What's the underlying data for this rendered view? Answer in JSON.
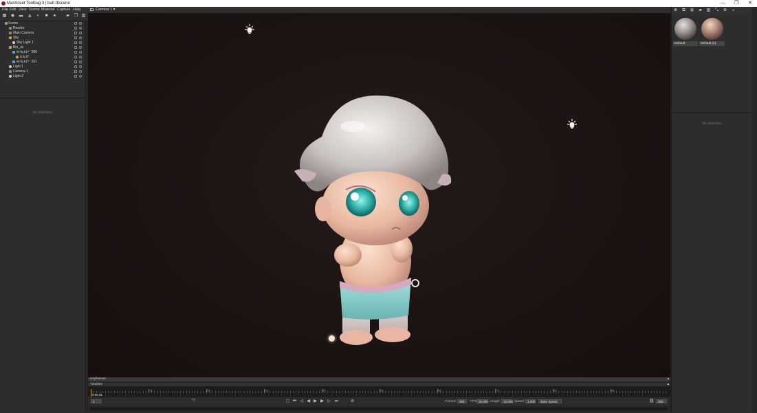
{
  "window": {
    "title": "Marmoset Toolbag 3  |  bah.tbscene",
    "controls": [
      "—",
      "❐",
      "✕"
    ]
  },
  "menu": [
    "File",
    "Edit",
    "View",
    "Scene",
    "Material",
    "Capture",
    "Help"
  ],
  "outliner": {
    "items": [
      {
        "label": "Scene",
        "icon": "scene-icon",
        "color": "#9a9a9a"
      },
      {
        "label": "Render",
        "icon": "render-icon",
        "color": "#62a84a"
      },
      {
        "label": "Main Camera",
        "icon": "camera-icon",
        "color": "#8a8a8a"
      },
      {
        "label": "Sky",
        "icon": "sky-icon",
        "color": "#c9a64a"
      },
      {
        "label": "Sky Light 1",
        "icon": "light-icon",
        "color": "#d4d4d4"
      },
      {
        "label": "Bin_uv",
        "icon": "folder-icon",
        "color": "#c9a64a"
      },
      {
        "label": "ä¹¹ä¸è‡ª  '  006",
        "icon": "mesh-icon",
        "color": "#5fa3c9"
      },
      {
        "label": "ä  ä  ä°·",
        "icon": "material-icon",
        "color": "#d09a3a"
      },
      {
        "label": "ä¹¹ä¸è‡ª  '  011",
        "icon": "mesh-icon",
        "color": "#5fa3c9"
      },
      {
        "label": "Light 1",
        "icon": "light-icon",
        "color": "#d4d4d4"
      },
      {
        "label": "Camera 1",
        "icon": "camera-icon",
        "color": "#8a8a8a"
      },
      {
        "label": "Light 2",
        "icon": "light-icon",
        "color": "#d4d4d4"
      }
    ]
  },
  "properties": {
    "empty_text": "No Selection"
  },
  "viewport": {
    "camera_label": "Camera 1 ▾"
  },
  "timeline": {
    "keyframes_label": "Keyframes",
    "timeline_label": "Timeline",
    "ticks": [
      "1s",
      "2s",
      "3s",
      "4s",
      "5s",
      "6s",
      "7s",
      "8s",
      "9s"
    ],
    "start_field": "1",
    "current_time": "0:00.01",
    "frames_label": "Frames",
    "frames_value": "300",
    "fps_label": "FPS",
    "fps_value": "30.000",
    "length_label": "Length",
    "length_value": "10.000",
    "speed_label": "Speed",
    "speed_value": "1.000",
    "bake_label": "Bake Speed",
    "end_field": "300"
  },
  "materials": {
    "items": [
      {
        "label": "Default"
      },
      {
        "label": "Default (1)"
      }
    ],
    "empty_text": "No Selection"
  },
  "colors": {
    "accent": "#cfa23b",
    "panel": "#2d2d2d",
    "viewport_bg": "#1d1514"
  }
}
